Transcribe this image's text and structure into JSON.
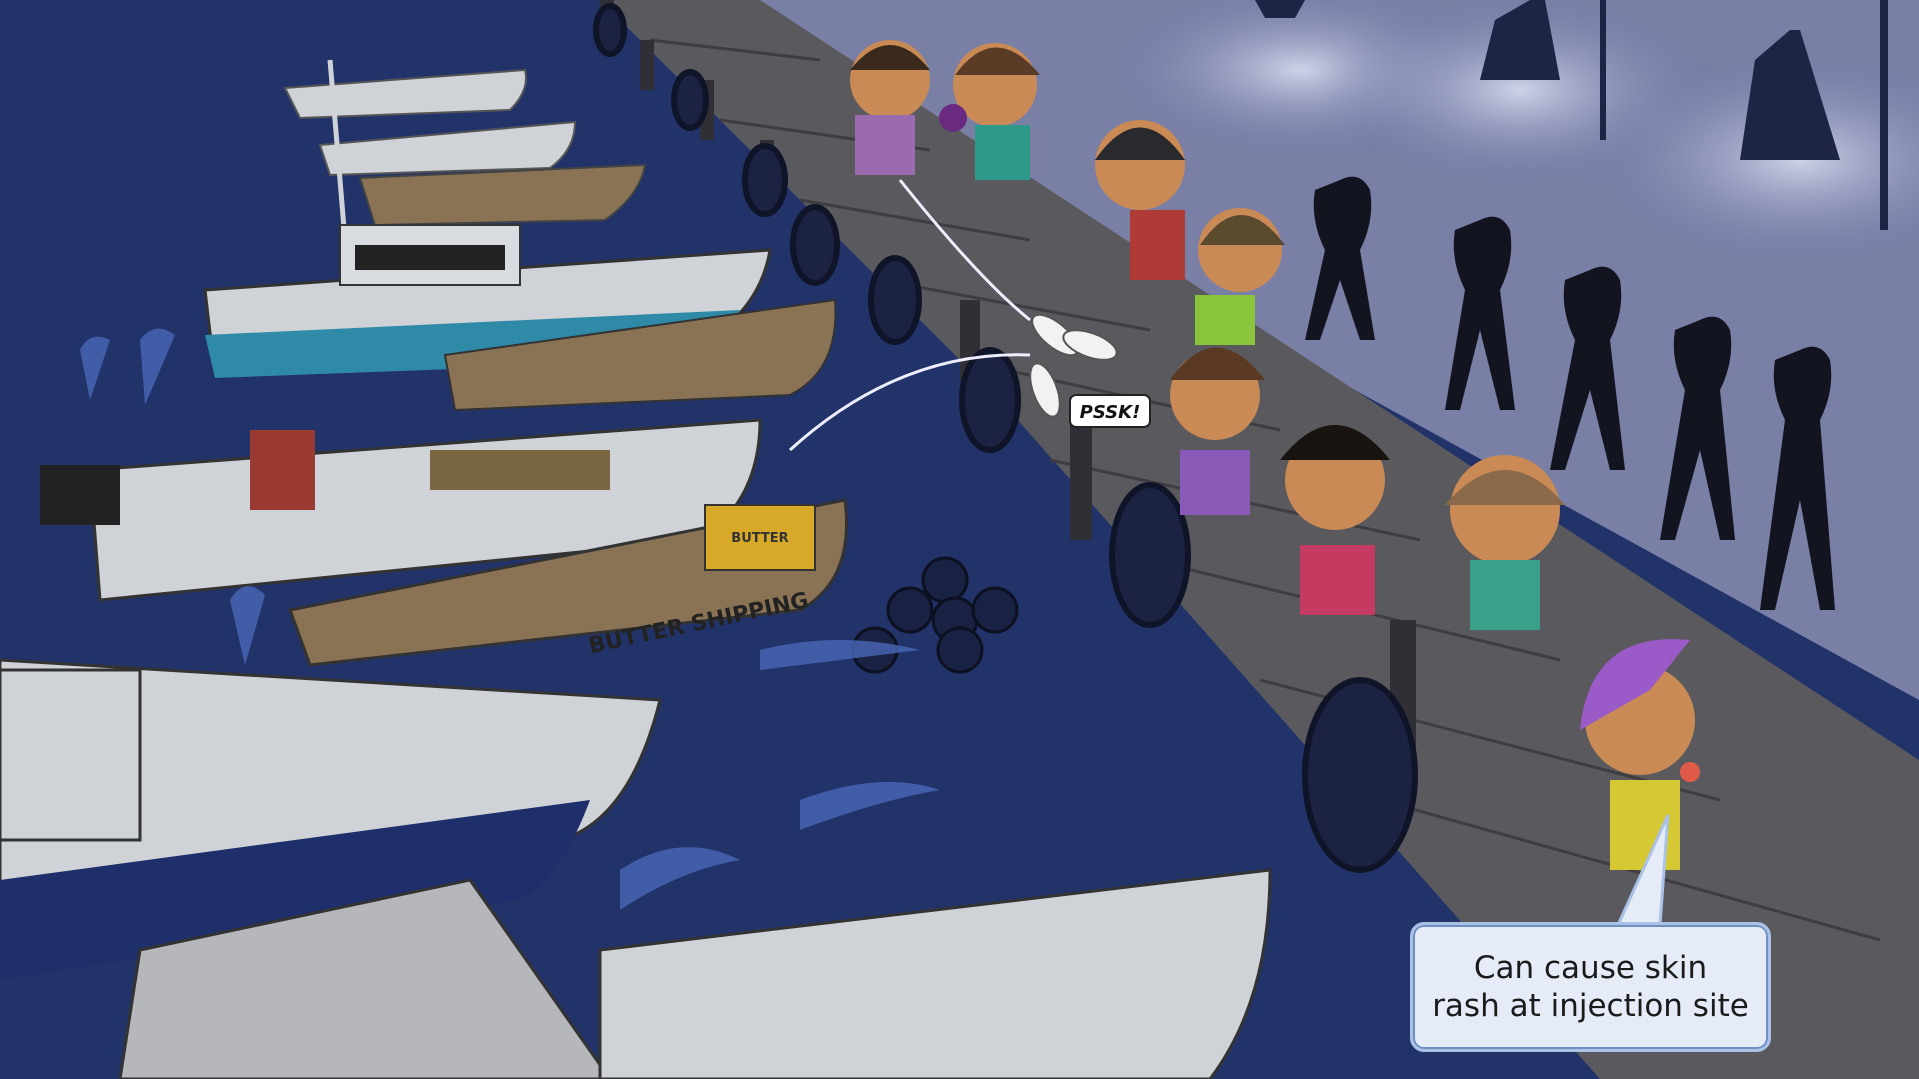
{
  "scene": {
    "kind": "cartoon-illustration",
    "background_color": "#1f2f5e",
    "boat_crate_label": "BUTTER",
    "boat_hull_label": "BUTTER SHIPPING",
    "sound_effect": "PSSK!",
    "callout_text": "Can cause skin\nrash at injection site"
  }
}
